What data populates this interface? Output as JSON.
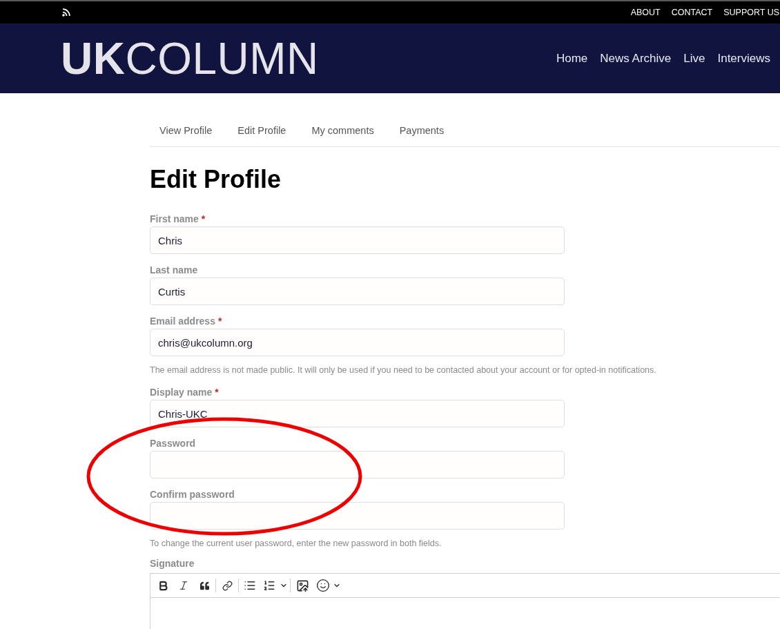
{
  "top_bar": {
    "links": [
      "ABOUT",
      "CONTACT",
      "SUPPORT US"
    ]
  },
  "header": {
    "logo": "**UK**COLUMN",
    "nav": [
      "Home",
      "News Archive",
      "Live",
      "Interviews"
    ]
  },
  "tabs": [
    {
      "label": "View Profile"
    },
    {
      "label": "Edit Profile"
    },
    {
      "label": "My comments"
    },
    {
      "label": "Payments"
    }
  ],
  "page_title": "Edit Profile",
  "fields": [
    {
      "label": "First name",
      "required_mark": "*",
      "value": "Chris"
    },
    {
      "label": "Last name",
      "value": "Curtis"
    },
    {
      "label": "Email address",
      "required_mark": "*",
      "value": "chris@ukcolumn.org",
      "help": "The email address is not made public. It will only be used if you need to be contacted about your account or for opted-in notifications."
    },
    {
      "label": "Display name",
      "required_mark": "*",
      "value": "Chris-UKC"
    },
    {
      "label": "Password"
    },
    {
      "label": "Confirm password",
      "help": "To change the current user password, enter the new password in both fields."
    }
  ],
  "signature": {
    "label": "Signature"
  }
}
